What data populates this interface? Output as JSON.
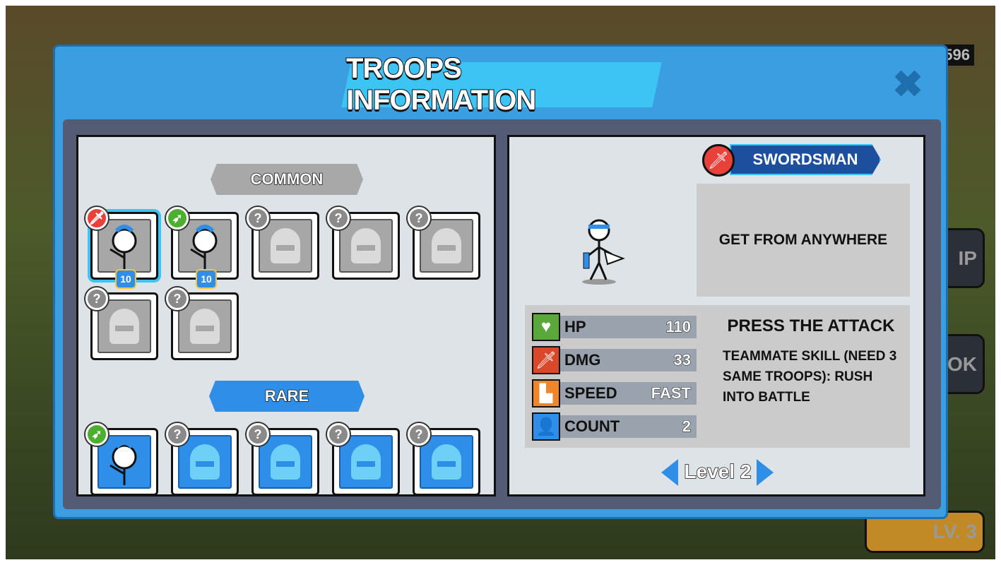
{
  "background": {
    "currency": "596",
    "buttons": [
      "IP",
      "OK"
    ],
    "level_label": "LV. 3"
  },
  "modal": {
    "title": "TROOPS INFORMATION",
    "close_icon": "close-icon"
  },
  "left": {
    "common_label": "COMMON",
    "rare_label": "RARE",
    "common_cards": [
      {
        "type": "sword",
        "level": "10",
        "unlocked": true,
        "selected": true
      },
      {
        "type": "arrow",
        "level": "10",
        "unlocked": true
      },
      {
        "type": "unknown",
        "badge": "?"
      },
      {
        "type": "unknown",
        "badge": "?"
      },
      {
        "type": "unknown",
        "badge": "?"
      },
      {
        "type": "unknown",
        "badge": "?"
      },
      {
        "type": "unknown",
        "badge": "?"
      }
    ],
    "rare_cards": [
      {
        "type": "arrow",
        "unlocked": true
      },
      {
        "type": "unknown",
        "badge": "?"
      },
      {
        "type": "unknown",
        "badge": "?"
      },
      {
        "type": "unknown",
        "badge": "?"
      },
      {
        "type": "unknown",
        "badge": "?"
      }
    ]
  },
  "right": {
    "name": "SWORDSMAN",
    "source": "GET FROM ANYWHERE",
    "stats": [
      {
        "label": "HP",
        "value": "110",
        "icon": "heart-icon",
        "color": "#5aa83a"
      },
      {
        "label": "DMG",
        "value": "33",
        "icon": "sword-icon",
        "color": "#d9482b"
      },
      {
        "label": "SPEED",
        "value": "FAST",
        "icon": "boot-icon",
        "color": "#f0862a"
      },
      {
        "label": "COUNT",
        "value": "2",
        "icon": "person-icon",
        "color": "#2f8fe8"
      }
    ],
    "skill_title": "PRESS THE ATTACK",
    "skill_desc": "TEAMMATE SKILL (NEED 3 SAME TROOPS): RUSH INTO BATTLE",
    "level": "Level 2"
  }
}
